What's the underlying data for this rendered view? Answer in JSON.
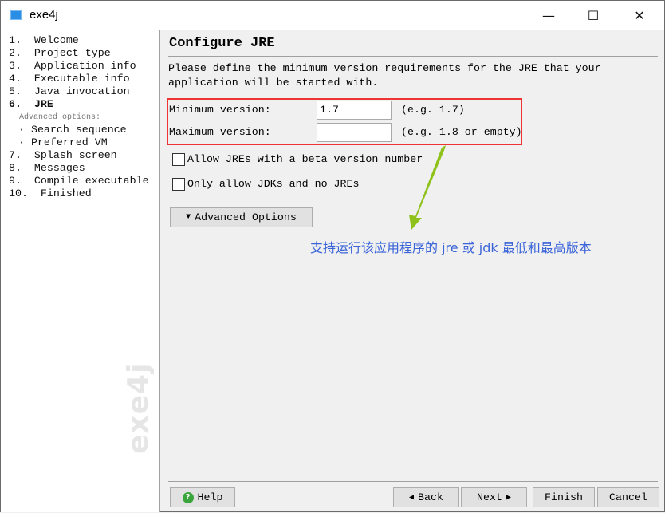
{
  "window": {
    "title": "exe4j",
    "minimize": "—",
    "maximize": "☐",
    "close": "✕"
  },
  "sidebar": {
    "items": [
      {
        "label": "1.  Welcome"
      },
      {
        "label": "2.  Project type"
      },
      {
        "label": "3.  Application info"
      },
      {
        "label": "4.  Executable info"
      },
      {
        "label": "5.  Java invocation"
      },
      {
        "label": "6.  JRE"
      },
      {
        "label": "Advanced options:"
      },
      {
        "label": "· Search sequence"
      },
      {
        "label": "· Preferred VM"
      },
      {
        "label": "7.  Splash screen"
      },
      {
        "label": "8.  Messages"
      },
      {
        "label": "9.  Compile executable"
      },
      {
        "label": "10.  Finished"
      }
    ],
    "watermark": "exe4j"
  },
  "main": {
    "title": "Configure JRE",
    "description": "Please define the minimum version requirements for the JRE that your\napplication will be started with.",
    "min_label": "Minimum version:",
    "min_value": "1.7",
    "min_hint": "(e.g. 1.7)",
    "max_label": "Maximum version:",
    "max_value": "",
    "max_hint": "(e.g. 1.8 or empty)",
    "beta_label": "Allow JREs with a beta version number",
    "beta_checked": false,
    "jdk_label": "Only allow JDKs and no JREs",
    "jdk_checked": false,
    "advanced_label": "Advanced Options",
    "annotation": "支持运行该应用程序的 jre 或 jdk 最低和最高版本"
  },
  "footer": {
    "help": "Help",
    "back": "Back",
    "next": "Next",
    "finish": "Finish",
    "cancel": "Cancel"
  },
  "colors": {
    "highlight": "#ee3333",
    "annotation": "#3a64d8",
    "arrow": "#8ec21a"
  }
}
